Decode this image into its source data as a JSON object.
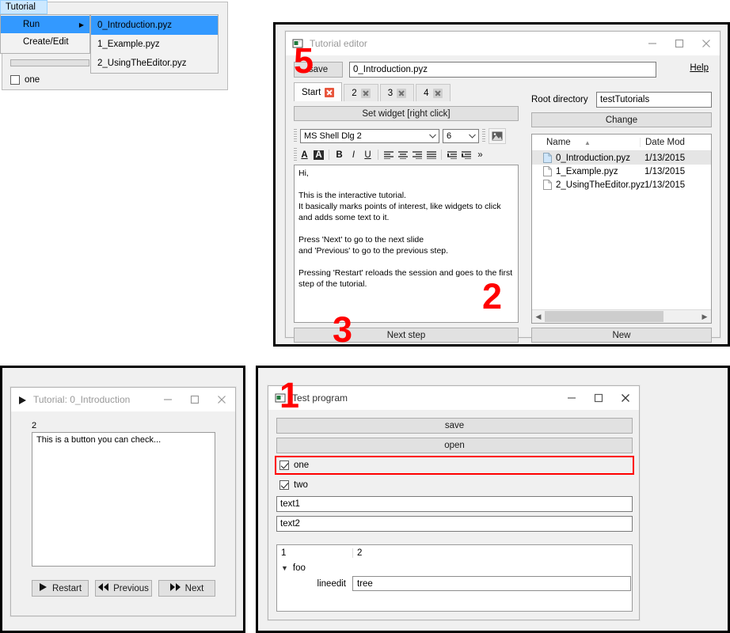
{
  "editor": {
    "window_title": "Tutorial editor",
    "save_label": "save",
    "filename_value": "0_Introduction.pyz",
    "help_label": "Help",
    "tabs": [
      {
        "label": "Start",
        "active": true
      },
      {
        "label": "2",
        "active": false
      },
      {
        "label": "3",
        "active": false
      },
      {
        "label": "4",
        "active": false
      }
    ],
    "set_widget_label": "Set widget [right click]",
    "font_family_value": "MS Shell Dlg 2",
    "font_size_value": "6",
    "format_buttons": [
      "A",
      "A",
      "B",
      "I",
      "U",
      "align-left",
      "align-center",
      "align-right",
      "align-justify",
      "indent-decrease",
      "indent-increase",
      "»"
    ],
    "editor_text": "Hi,\n\nThis is the interactive tutorial.\nIt basically marks points of interest, like widgets to click and adds some text to it.\n\nPress 'Next' to go to the next slide\nand 'Previous' to go to the previous step.\n\nPressing 'Restart' reloads the session and goes to the first step of the tutorial.",
    "next_step_label": "Next step",
    "root_directory_label": "Root directory",
    "root_directory_value": "testTutorials",
    "change_label": "Change",
    "new_label": "New",
    "file_columns": [
      "Name",
      "Date Mod"
    ],
    "files": [
      {
        "name": "0_Introduction.pyz",
        "date": "1/13/2015",
        "selected": true
      },
      {
        "name": "1_Example.pyz",
        "date": "1/13/2015",
        "selected": false
      },
      {
        "name": "2_UsingTheEditor.pyz",
        "date": "1/13/2015",
        "selected": false
      }
    ]
  },
  "menu": {
    "title": "Tutorial",
    "items": [
      {
        "label": "Run",
        "has_submenu": true,
        "highlighted": true
      },
      {
        "label": "Create/Edit",
        "has_submenu": false,
        "highlighted": false
      }
    ],
    "submenu": [
      {
        "label": "0_Introduction.pyz",
        "highlighted": true
      },
      {
        "label": "1_Example.pyz",
        "highlighted": false
      },
      {
        "label": "2_UsingTheEditor.pyz",
        "highlighted": false
      }
    ],
    "background_checkbox_label": "one"
  },
  "viewer": {
    "window_title": "Tutorial: 0_Introduction",
    "step_number": "2",
    "step_text": "This is a button you can check...",
    "buttons": [
      {
        "label": "Restart",
        "icon": "play-icon"
      },
      {
        "label": "Previous",
        "icon": "rewind-icon"
      },
      {
        "label": "Next",
        "icon": "fast-forward-icon"
      }
    ]
  },
  "test_program": {
    "window_title": "Test program",
    "save_label": "save",
    "open_label": "open",
    "checkbox_one": {
      "label": "one",
      "checked": true,
      "highlighted": true
    },
    "checkbox_two": {
      "label": "two",
      "checked": true,
      "highlighted": false
    },
    "text1_value": "text1",
    "text2_value": "text2",
    "tree": {
      "columns": [
        "1",
        "2"
      ],
      "root_label": "foo",
      "child_label": "lineedit",
      "child_value": "tree"
    }
  },
  "annotations": [
    {
      "number": "1",
      "color": "#ff0000"
    },
    {
      "number": "2",
      "color": "#ff0000"
    },
    {
      "number": "3",
      "color": "#ff0000"
    },
    {
      "number": "5",
      "color": "#ff0000"
    }
  ]
}
